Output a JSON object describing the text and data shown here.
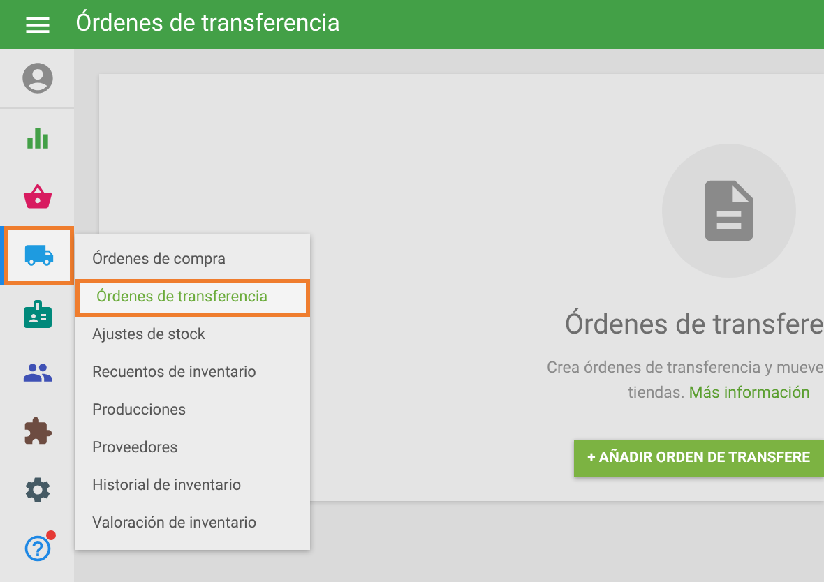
{
  "header": {
    "title": "Órdenes de transferencia"
  },
  "sidebar": {
    "items": [
      {
        "kind": "account",
        "selected": false,
        "notification": false
      },
      {
        "kind": "reports",
        "selected": false,
        "notification": false
      },
      {
        "kind": "sales",
        "selected": false,
        "notification": false
      },
      {
        "kind": "inventory",
        "selected": true,
        "notification": false
      },
      {
        "kind": "employees",
        "selected": false,
        "notification": false
      },
      {
        "kind": "customers",
        "selected": false,
        "notification": false
      },
      {
        "kind": "integrations",
        "selected": false,
        "notification": false
      },
      {
        "kind": "settings",
        "selected": false,
        "notification": false
      },
      {
        "kind": "help",
        "selected": false,
        "notification": true
      }
    ]
  },
  "submenu": {
    "items": [
      {
        "label": "Órdenes de compra",
        "selected": false
      },
      {
        "label": "Órdenes de transferencia",
        "selected": true
      },
      {
        "label": "Ajustes de stock",
        "selected": false
      },
      {
        "label": "Recuentos de inventario",
        "selected": false
      },
      {
        "label": "Producciones",
        "selected": false
      },
      {
        "label": "Proveedores",
        "selected": false
      },
      {
        "label": "Historial de inventario",
        "selected": false
      },
      {
        "label": "Valoración de inventario",
        "selected": false
      }
    ]
  },
  "empty_state": {
    "title": "Órdenes de transfere",
    "description_line_1": "Crea órdenes de transferencia y mueve",
    "description_line_2": "tiendas.",
    "link": "Más información",
    "button": "+ AÑADIR ORDEN DE TRANSFERE"
  }
}
